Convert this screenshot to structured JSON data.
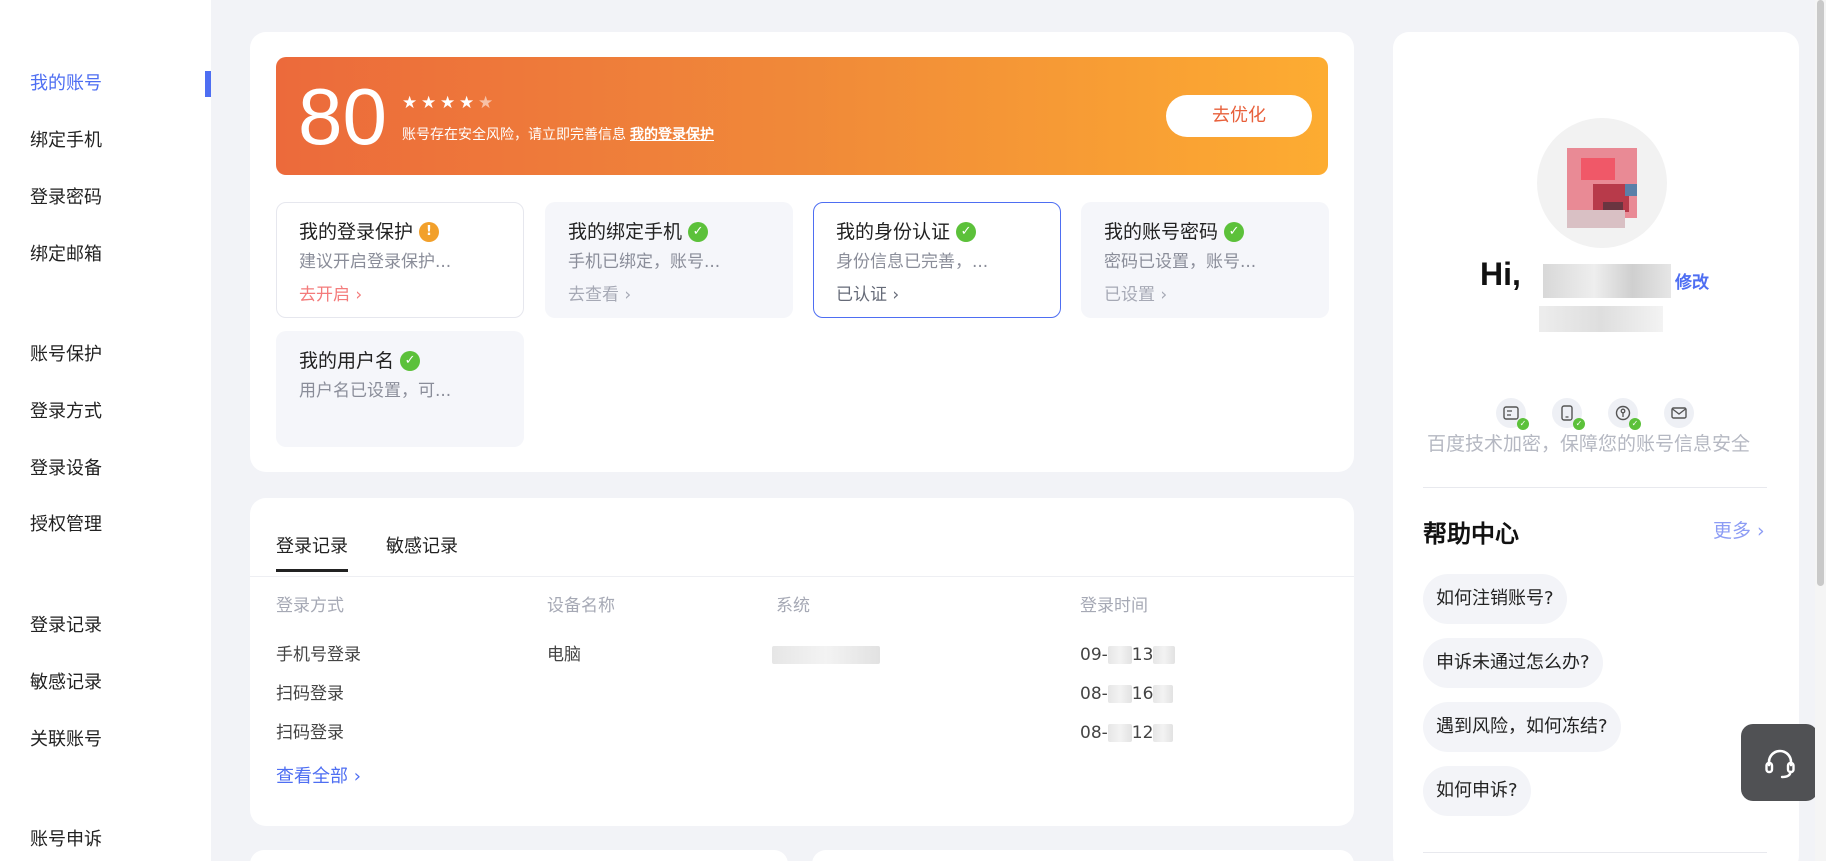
{
  "sidebar": {
    "items": [
      {
        "label": "我的账号"
      },
      {
        "label": "绑定手机"
      },
      {
        "label": "登录密码"
      },
      {
        "label": "绑定邮箱"
      },
      {
        "label": "账号保护"
      },
      {
        "label": "登录方式"
      },
      {
        "label": "登录设备"
      },
      {
        "label": "授权管理"
      },
      {
        "label": "登录记录"
      },
      {
        "label": "敏感记录"
      },
      {
        "label": "关联账号"
      },
      {
        "label": "账号申诉"
      }
    ],
    "active_index": 0,
    "accent": "#4e6ef2"
  },
  "banner": {
    "score": "80",
    "stars_filled": 4,
    "stars_total": 5,
    "tip": "账号存在安全风险，请立即完善信息",
    "tip_link": "我的登录保护",
    "button": "去优化"
  },
  "security": {
    "items": [
      {
        "title": "我的登录保护",
        "status": "warn",
        "status_icon": "warning-icon",
        "desc": "建议开启登录保护...",
        "link": "去开启 ›"
      },
      {
        "title": "我的绑定手机",
        "status": "ok",
        "status_icon": "check-icon",
        "desc": "手机已绑定，账号...",
        "link": "去查看 ›"
      },
      {
        "title": "我的身份认证",
        "status": "ok",
        "status_icon": "check-icon",
        "desc": "身份信息已完善，...",
        "link": "已认证 ›"
      },
      {
        "title": "我的账号密码",
        "status": "ok",
        "status_icon": "check-icon",
        "desc": "密码已设置，账号...",
        "link": "已设置 ›"
      },
      {
        "title": "我的用户名",
        "status": "ok",
        "status_icon": "check-icon",
        "desc": "用户名已设置，可..."
      }
    ]
  },
  "records": {
    "tabs": [
      "登录记录",
      "敏感记录"
    ],
    "active_tab": 0,
    "columns": [
      "登录方式",
      "设备名称",
      "系统",
      "登录时间"
    ],
    "rows": [
      {
        "method": "手机号登录",
        "device": "电脑",
        "time_prefix": "09-",
        "time_mid": "13"
      },
      {
        "method": "扫码登录",
        "device": "",
        "time_prefix": "08-",
        "time_mid": "16"
      },
      {
        "method": "扫码登录",
        "device": "",
        "time_prefix": "08-",
        "time_mid": "12"
      }
    ],
    "view_all": "查看全部 ›"
  },
  "profile": {
    "greeting": "Hi,",
    "modify": "修改",
    "secure_text": "百度技术加密，保障您的账号信息安全",
    "icons": [
      "id-card-icon",
      "phone-icon",
      "key-icon",
      "mail-icon"
    ]
  },
  "help": {
    "title": "帮助中心",
    "more": "更多 ›",
    "faqs": [
      "如何注销账号?",
      "申诉未通过怎么办?",
      "遇到风险，如何冻结?",
      "如何申诉?"
    ]
  },
  "colors": {
    "banner_start": "#ec6a3b",
    "banner_end": "#fdac31",
    "ok": "#5cc13a",
    "warn": "#f2a02b",
    "link_red": "#f47b7b"
  }
}
